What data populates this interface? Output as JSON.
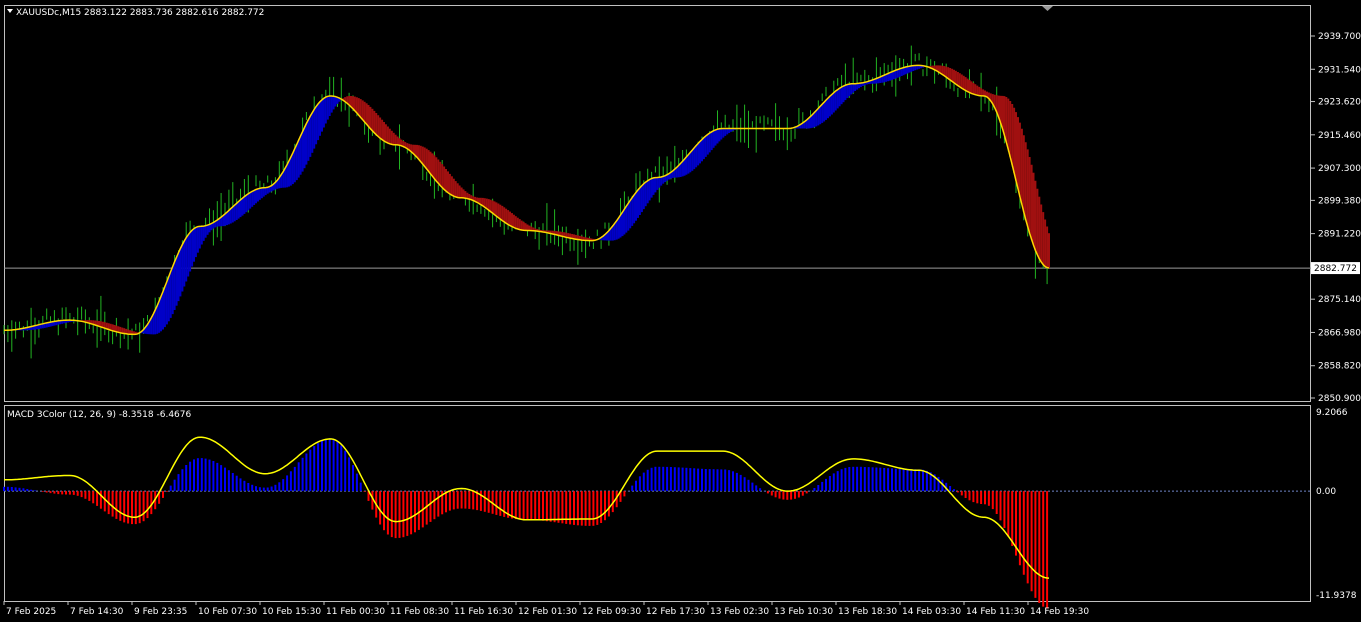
{
  "colors": {
    "background": "#000000",
    "frame": "#c0c0c0",
    "bull_candle": "#22b422",
    "ribbon_bull": "#0000c8",
    "ribbon_bear": "#a01010",
    "ma_line": "#ffd700",
    "macd_pos": "#0000ff",
    "macd_neg": "#ff0000",
    "signal": "#ffff00",
    "zero_line": "#6f86c8",
    "bid_line": "#9a9a9a",
    "text": "#ffffff"
  },
  "header": {
    "symbol_info": "XAUUSDc,M15  2883.122 2883.736 2882.616 2882.772",
    "dropdown_icon": "triangle-down-icon"
  },
  "indicator": {
    "title": "MACD 3Color (12, 26, 9)  -8.3518 -6.4676"
  },
  "price_axis": {
    "ticks": [
      "2939.700",
      "2931.540",
      "2923.620",
      "2915.460",
      "2907.300",
      "2899.380",
      "2891.220",
      "2883.060",
      "2875.140",
      "2866.980",
      "2858.820",
      "2850.900"
    ],
    "current_price": "2882.772"
  },
  "macd_axis": {
    "top": "9.2066",
    "zero": "0.00",
    "bottom": "-11.9378"
  },
  "time_axis": {
    "labels": [
      "7 Feb 2025",
      "7 Feb 14:30",
      "9 Feb 23:35",
      "10 Feb 07:30",
      "10 Feb 15:30",
      "11 Feb 00:30",
      "11 Feb 08:30",
      "11 Feb 16:30",
      "12 Feb 01:30",
      "12 Feb 09:30",
      "12 Feb 17:30",
      "13 Feb 02:30",
      "13 Feb 10:30",
      "13 Feb 18:30",
      "14 Feb 03:30",
      "14 Feb 11:30",
      "14 Feb 19:30"
    ]
  },
  "chart_data": {
    "type": "line",
    "ylim": [
      2850.9,
      2939.7
    ],
    "x": [
      "7 Feb 2025",
      "7 Feb 14:30",
      "9 Feb 23:35",
      "10 Feb 07:30",
      "10 Feb 15:30",
      "11 Feb 00:30",
      "11 Feb 08:30",
      "11 Feb 16:30",
      "12 Feb 01:30",
      "12 Feb 09:30",
      "12 Feb 17:30",
      "13 Feb 02:30",
      "13 Feb 10:30",
      "13 Feb 18:30",
      "14 Feb 03:30",
      "14 Feb 11:30",
      "14 Feb 19:30"
    ],
    "series": [
      {
        "values": [
          2867.5,
          2870.0,
          2866.5,
          2893.0,
          2902.5,
          2925.0,
          2913.0,
          2900.0,
          2892.0,
          2889.5,
          2905.0,
          2917.0,
          2917.0,
          2928.0,
          2932.5,
          2925.0,
          2882.8
        ]
      }
    ],
    "macd": {
      "ylim": [
        -11.9378,
        9.2066
      ],
      "zero_frac": 0.375,
      "hist": [
        0.5,
        -0.4,
        -3.8,
        3.8,
        0.4,
        6.0,
        -5.4,
        -2.0,
        -3.3,
        -4.0,
        2.8,
        2.5,
        -1.0,
        2.8,
        2.5,
        -1.5,
        -13.5
      ],
      "signal": [
        1.3,
        1.8,
        -3.0,
        6.2,
        2.0,
        6.0,
        -3.5,
        0.3,
        -3.3,
        -3.2,
        4.6,
        4.6,
        0.0,
        3.7,
        2.4,
        -3.0,
        -10.0
      ]
    }
  }
}
